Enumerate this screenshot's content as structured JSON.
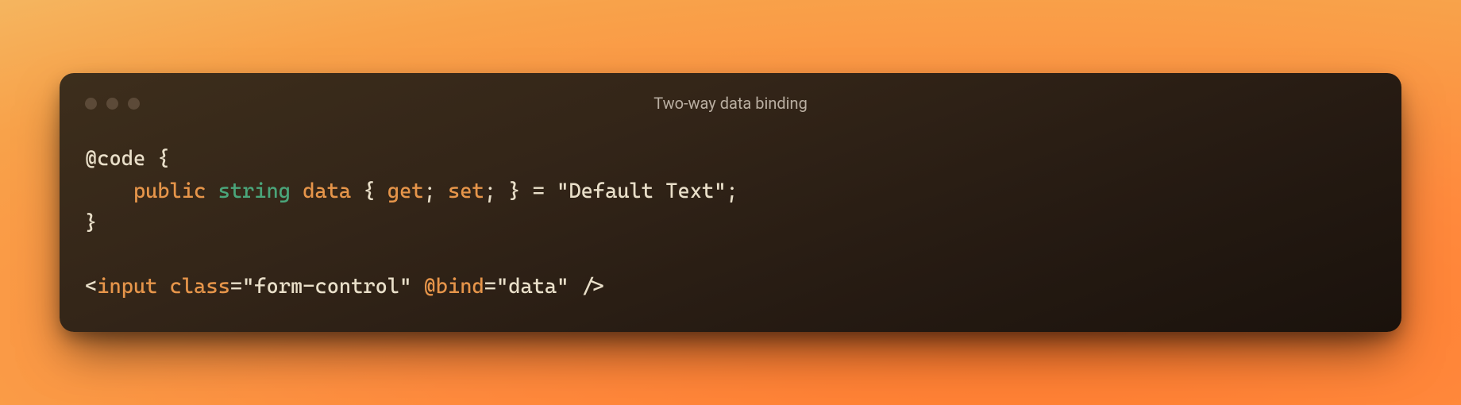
{
  "window": {
    "title": "Two-way data binding"
  },
  "code": {
    "line1": {
      "at": "@",
      "code_kw": "code",
      "space": " ",
      "brace_open": "{"
    },
    "line2": {
      "indent": "    ",
      "public": "public",
      "sp1": " ",
      "string": "string",
      "sp2": " ",
      "data": "data",
      "sp3": " ",
      "brace_open": "{",
      "sp4": " ",
      "get": "get",
      "semi1": ";",
      "sp5": " ",
      "set": "set",
      "semi2": ";",
      "sp6": " ",
      "brace_close": "}",
      "sp7": " ",
      "equals": "=",
      "sp8": " ",
      "str": "\"Default Text\"",
      "semi3": ";"
    },
    "line3": {
      "brace_close": "}"
    },
    "line5": {
      "lt": "<",
      "tag": "input",
      "sp1": " ",
      "attr_class": "class",
      "eq1": "=",
      "val_class": "\"form-control\"",
      "sp2": " ",
      "bind_dir": "@bind",
      "eq2": "=",
      "val_bind": "\"data\"",
      "sp3": " ",
      "slashgt": "/>"
    }
  }
}
